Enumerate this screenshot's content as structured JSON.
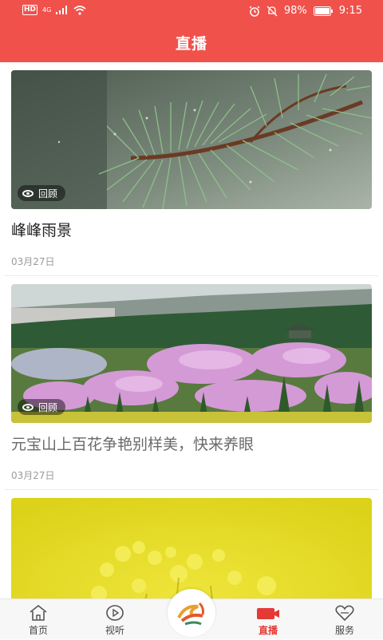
{
  "status": {
    "battery": "98%",
    "time": "9:15",
    "hd": "HD",
    "net": "4G"
  },
  "header": {
    "title": "直播"
  },
  "cards": [
    {
      "title": "峰峰雨景",
      "date": "03月27日",
      "badge": "回顾"
    },
    {
      "title": "元宝山上百花争艳别样美，快来养眼",
      "date": "03月27日",
      "badge": "回顾"
    }
  ],
  "tabs": [
    {
      "label": "首页",
      "icon": "home-icon"
    },
    {
      "label": "视听",
      "icon": "play-icon"
    },
    {
      "label": "",
      "icon": "app-logo-icon"
    },
    {
      "label": "直播",
      "icon": "video-camera-icon",
      "active": true
    },
    {
      "label": "服务",
      "icon": "heart-service-icon"
    }
  ],
  "colors": {
    "brand": "#f0514b",
    "active_tab": "#e53935"
  }
}
